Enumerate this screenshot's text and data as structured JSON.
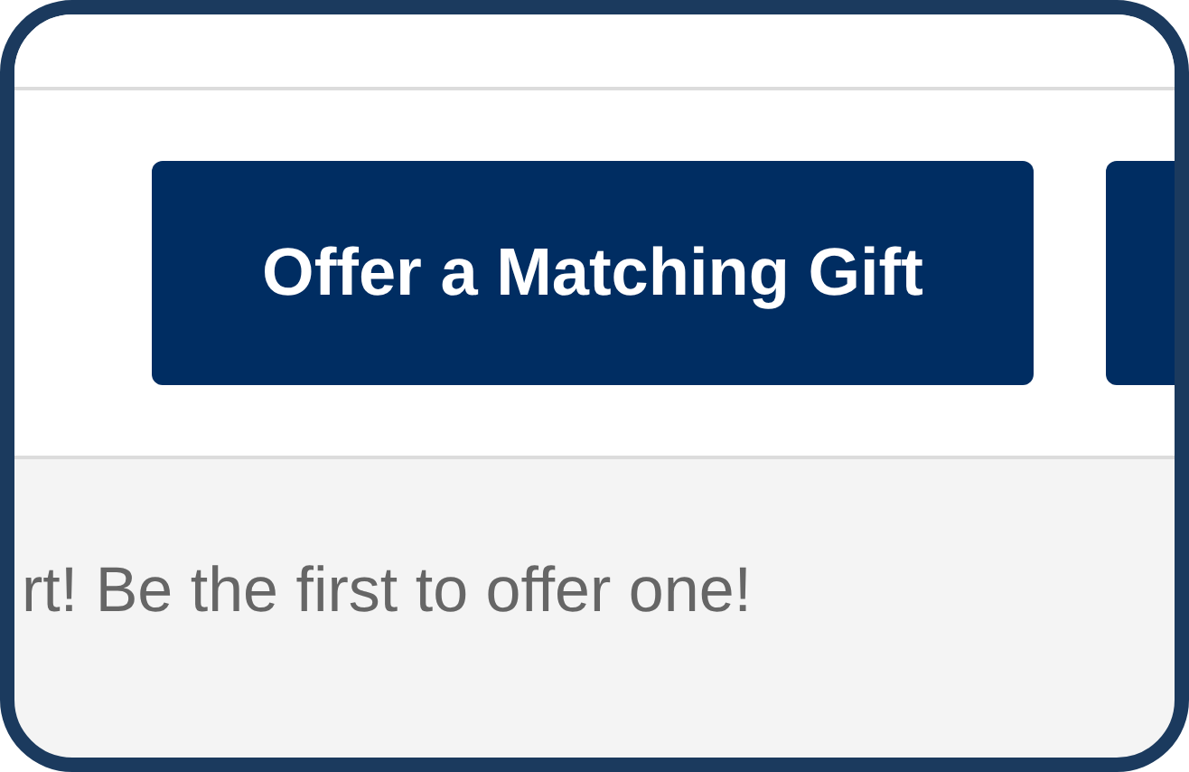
{
  "actions": {
    "primary_button": "Offer a Matching Gift"
  },
  "message": "rt! Be the first to offer one!"
}
